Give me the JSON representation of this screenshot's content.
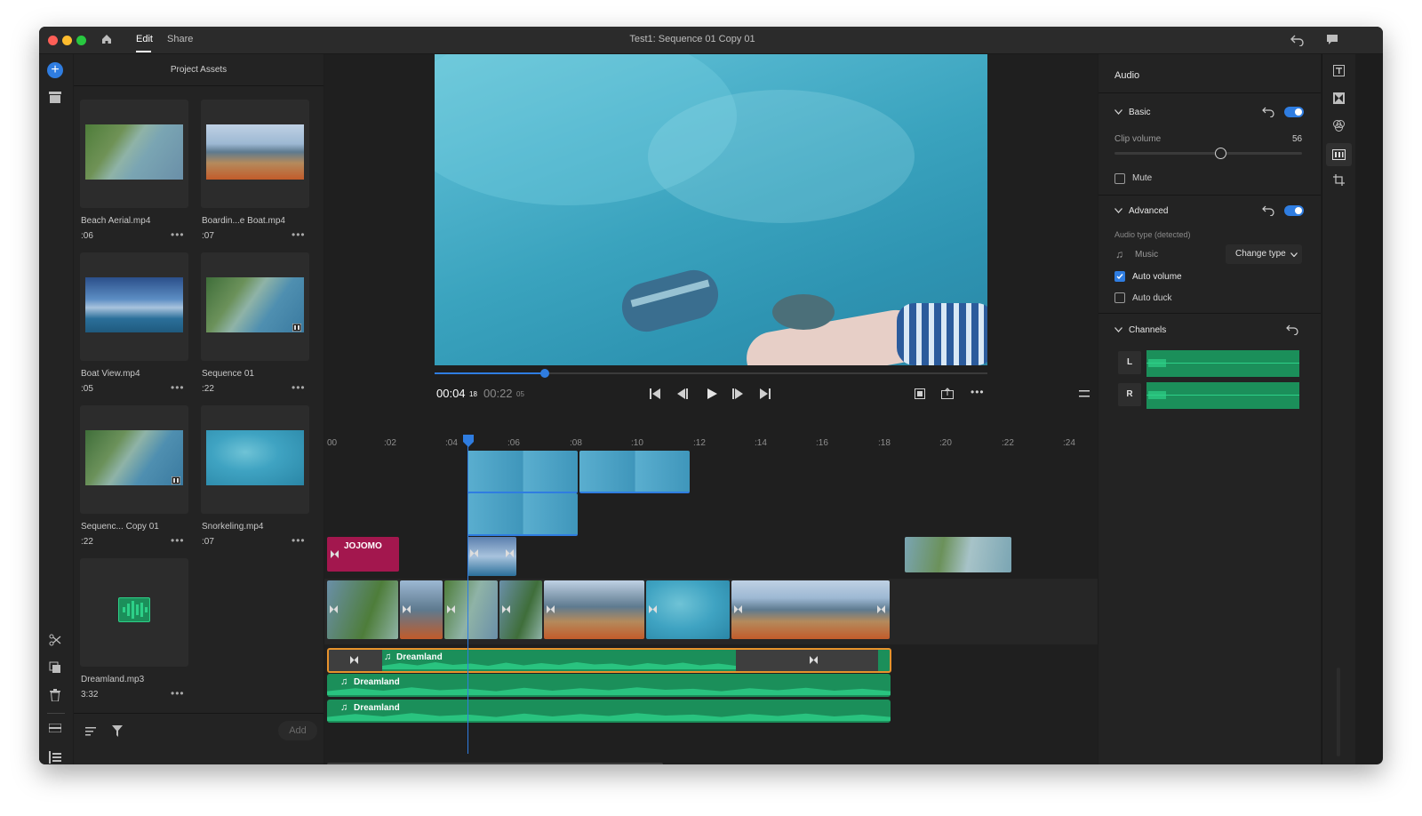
{
  "titlebar": {
    "tab_edit": "Edit",
    "tab_share": "Share",
    "title": "Test1: Sequence 01 Copy 01"
  },
  "assets": {
    "header": "Project Assets",
    "items": [
      {
        "name": "Beach Aerial.mp4",
        "duration": ":06"
      },
      {
        "name": "Boardin...e Boat.mp4",
        "duration": ":07"
      },
      {
        "name": "Boat View.mp4",
        "duration": ":05"
      },
      {
        "name": "Sequence 01",
        "duration": ":22"
      },
      {
        "name": "Sequenc... Copy 01",
        "duration": ":22"
      },
      {
        "name": "Snorkeling.mp4",
        "duration": ":07"
      },
      {
        "name": "Dreamland.mp3",
        "duration": "3:32"
      }
    ],
    "add_label": "Add"
  },
  "player": {
    "current_time": "00:04",
    "current_frames": "18",
    "total_time": "00:22",
    "total_frames": "05",
    "scrub_progress": 0.2
  },
  "timeline": {
    "ticks": [
      "00",
      ":02",
      ":04",
      ":06",
      ":08",
      ":10",
      ":12",
      ":14",
      ":16",
      ":18",
      ":20",
      ":22",
      ":24"
    ],
    "title_clip": "JOJOMO",
    "audio_track_1": "Dreamland",
    "audio_track_2": "Dreamland",
    "audio_track_3": "Dreamland"
  },
  "audio_panel": {
    "header": "Audio",
    "basic": "Basic",
    "clip_volume_label": "Clip volume",
    "clip_volume_value": "56",
    "mute": "Mute",
    "advanced": "Advanced",
    "audio_type_label": "Audio type (detected)",
    "music": "Music",
    "change_type": "Change type",
    "auto_volume": "Auto volume",
    "auto_duck": "Auto duck",
    "channels": "Channels",
    "left": "L",
    "right": "R"
  },
  "colors": {
    "accent": "#2f7de1",
    "audio": "#1b8f5a",
    "title_clip": "#a3174e",
    "selected_audio_border": "#e8932c"
  }
}
